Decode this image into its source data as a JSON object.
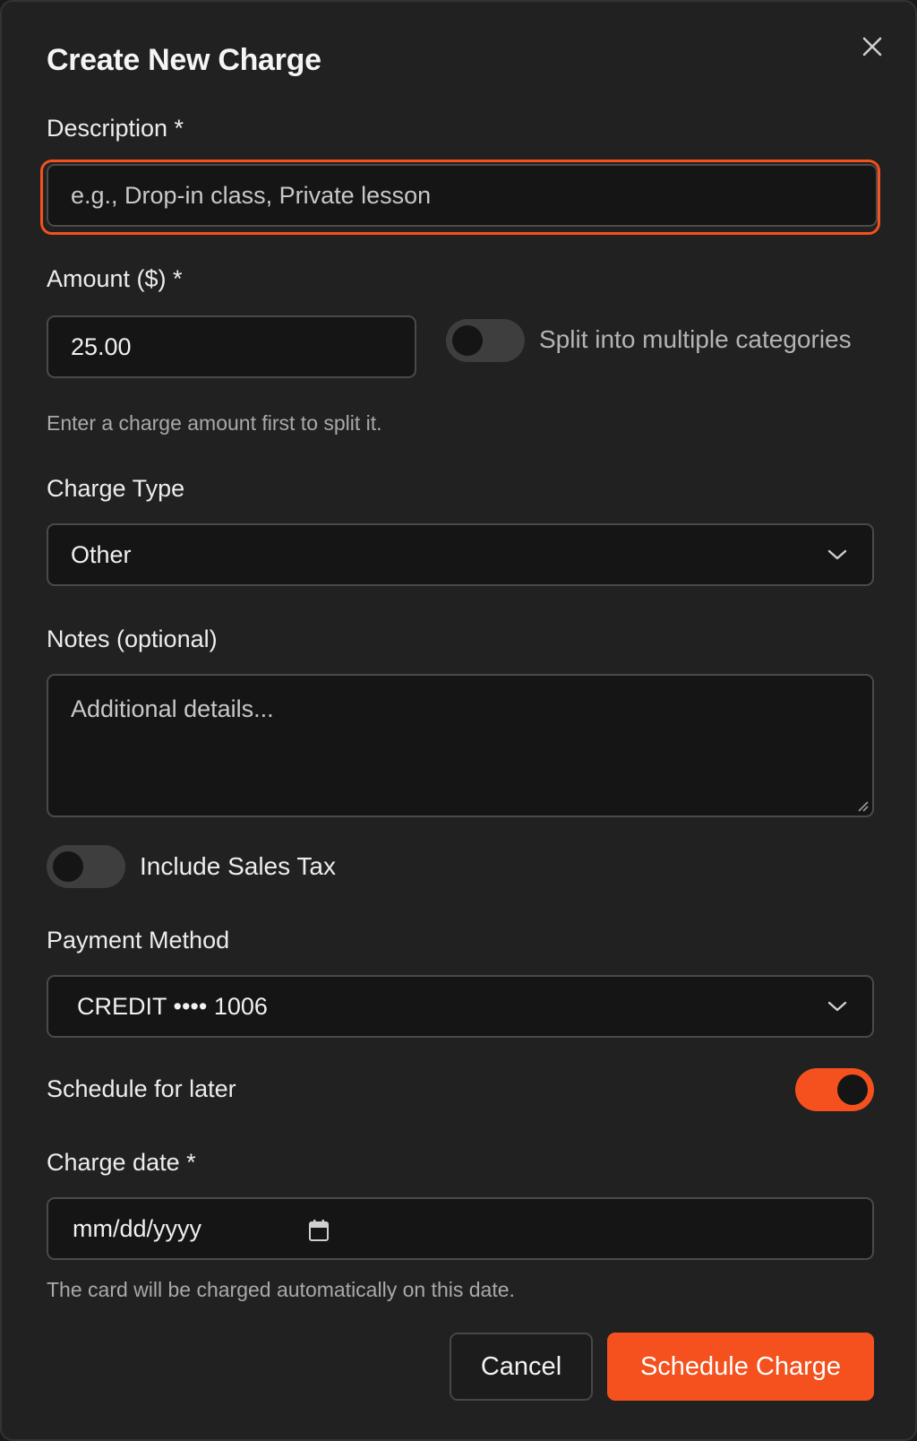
{
  "dialog": {
    "title": "Create New Charge",
    "close_icon": "close-icon"
  },
  "description": {
    "label": "Description *",
    "placeholder": "e.g., Drop-in class, Private lesson",
    "value": ""
  },
  "amount": {
    "label": "Amount ($) *",
    "value": "25.00",
    "hint": "Enter a charge amount first to split it."
  },
  "split": {
    "label": "Split into multiple categories",
    "enabled": false
  },
  "charge_type": {
    "label": "Charge Type",
    "selected": "Other"
  },
  "notes": {
    "label": "Notes (optional)",
    "placeholder": "Additional details..."
  },
  "sales_tax": {
    "label": "Include Sales Tax",
    "enabled": false
  },
  "payment_method": {
    "label": "Payment Method",
    "selected": "CREDIT •••• 1006"
  },
  "schedule": {
    "label": "Schedule for later",
    "enabled": true
  },
  "charge_date": {
    "label": "Charge date *",
    "placeholder": "mm/dd/yyyy",
    "hint": "The card will be charged automatically on this date."
  },
  "buttons": {
    "cancel": "Cancel",
    "submit": "Schedule Charge"
  },
  "colors": {
    "accent": "#f4511e",
    "background": "#212121",
    "field": "#151515"
  }
}
